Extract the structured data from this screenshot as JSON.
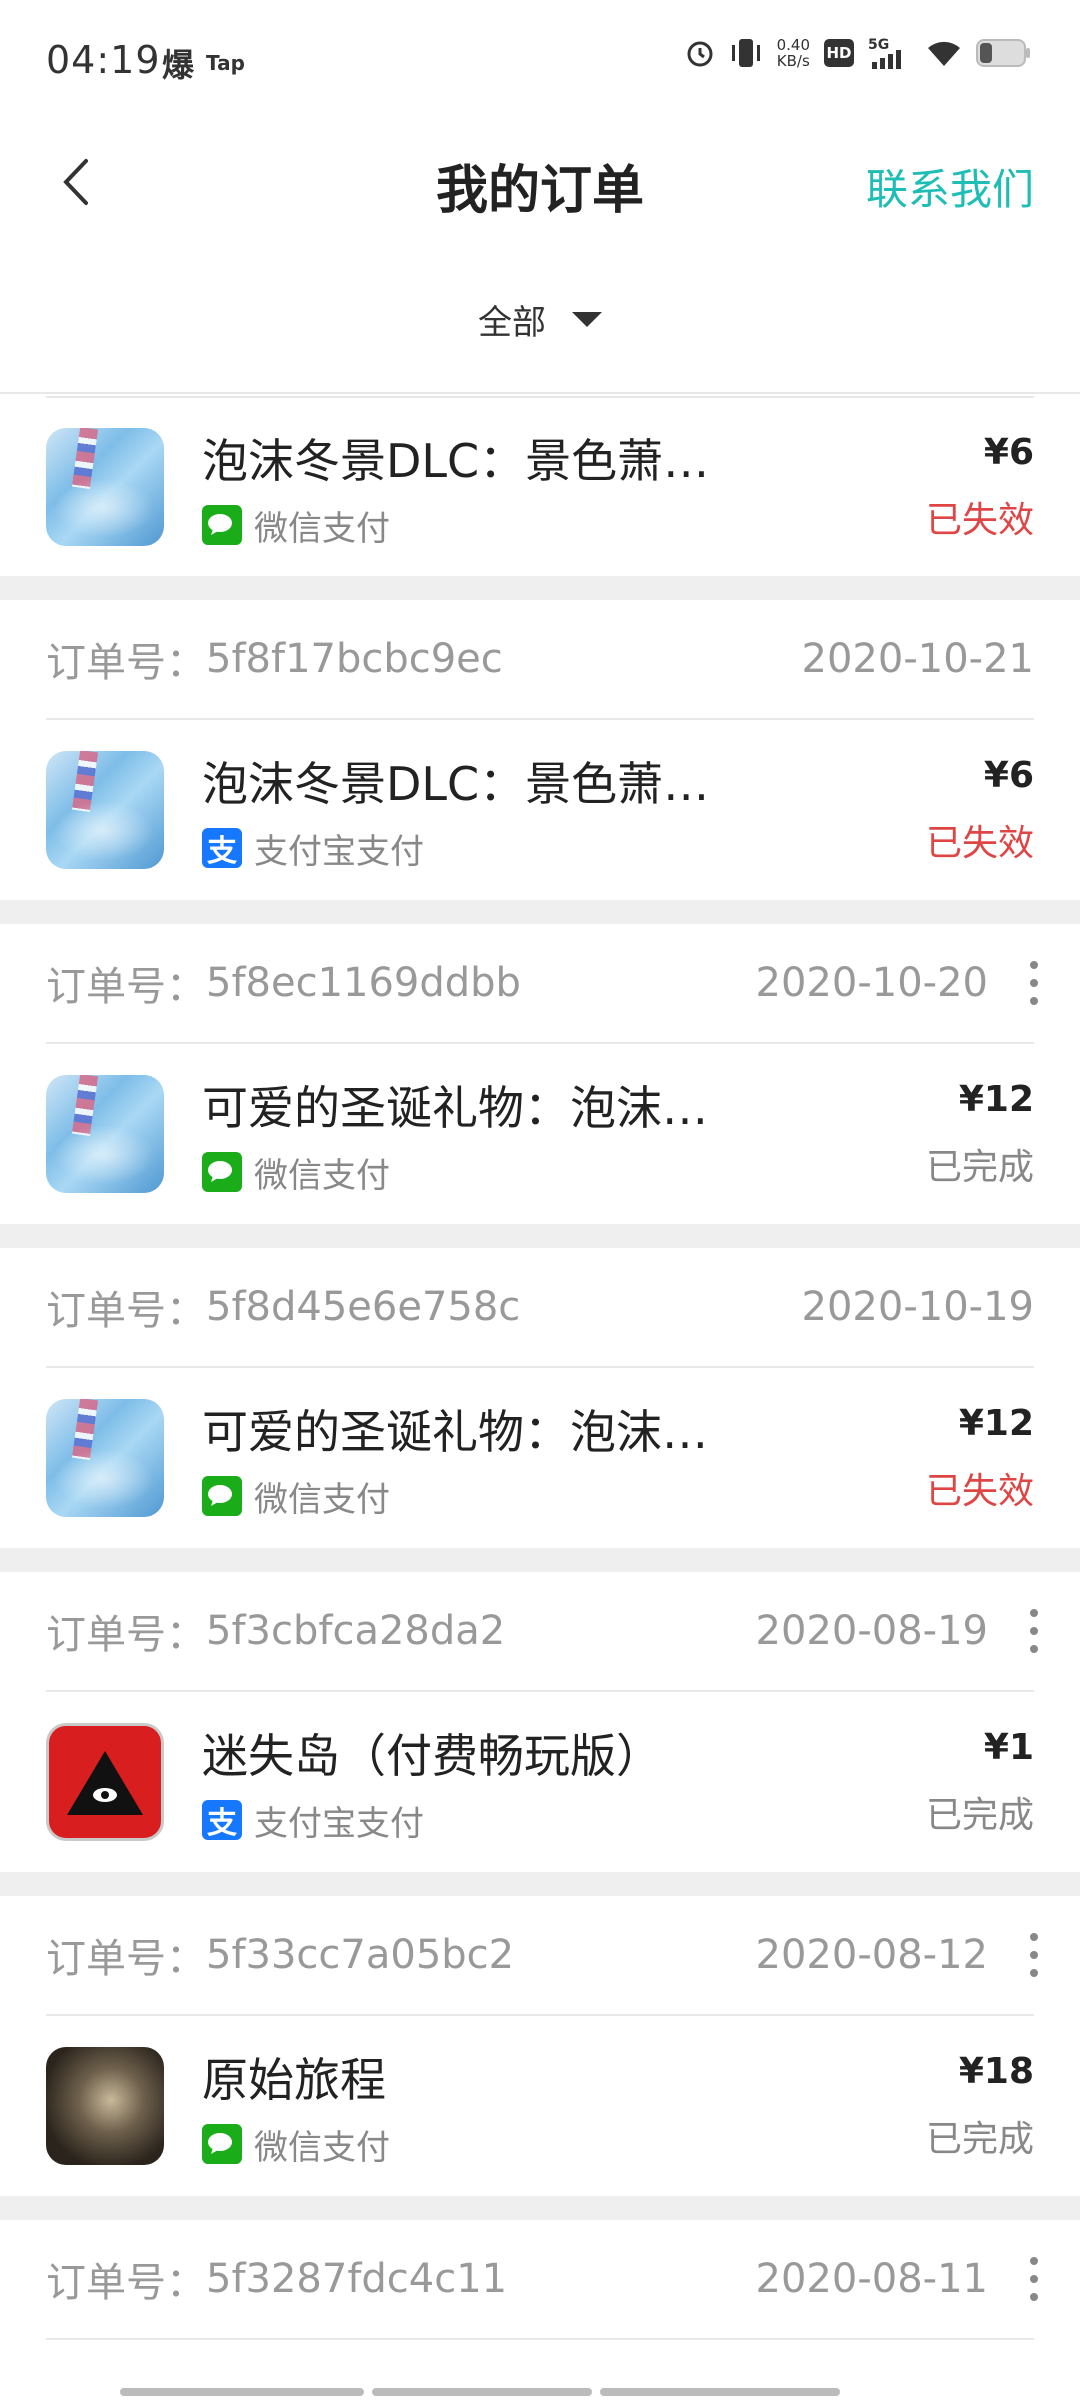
{
  "status_bar": {
    "time": "04:19",
    "left_icons": [
      "爆",
      "Tap"
    ],
    "net_speed_value": "0.40",
    "net_speed_unit": "KB/s",
    "hd": "HD",
    "network": "5G"
  },
  "header": {
    "title": "我的订单",
    "contact": "联系我们"
  },
  "filter": {
    "label": "全部"
  },
  "orders": [
    {
      "id_label": "",
      "id": "",
      "date": "",
      "name": "泡沫冬景DLC：景色萧瑟的冬日",
      "payment": "微信支付",
      "payment_type": "wechat",
      "price": "¥6",
      "status": "已失效",
      "status_type": "invalid",
      "thumb": "bubble"
    },
    {
      "id_label": "订单号：",
      "id": "5f8f17bcbc9ec",
      "date": "2020-10-21",
      "name": "泡沫冬景DLC：景色萧瑟的冬日",
      "payment": "支付宝支付",
      "payment_type": "alipay",
      "price": "¥6",
      "status": "已失效",
      "status_type": "invalid",
      "thumb": "bubble"
    },
    {
      "id_label": "订单号：",
      "id": "5f8ec1169ddbb",
      "date": "2020-10-20",
      "name": "可爱的圣诞礼物：泡沫冬景",
      "payment": "微信支付",
      "payment_type": "wechat",
      "price": "¥12",
      "status": "已完成",
      "status_type": "done",
      "thumb": "bubble"
    },
    {
      "id_label": "订单号：",
      "id": "5f8d45e6e758c",
      "date": "2020-10-19",
      "name": "可爱的圣诞礼物：泡沫冬景",
      "payment": "微信支付",
      "payment_type": "wechat",
      "price": "¥12",
      "status": "已失效",
      "status_type": "invalid",
      "thumb": "bubble"
    },
    {
      "id_label": "订单号：",
      "id": "5f3cbfca28da2",
      "date": "2020-08-19",
      "name": "迷失岛（付费畅玩版）",
      "payment": "支付宝支付",
      "payment_type": "alipay",
      "price": "¥1",
      "status": "已完成",
      "status_type": "done",
      "thumb": "lost"
    },
    {
      "id_label": "订单号：",
      "id": "5f33cc7a05bc2",
      "date": "2020-08-12",
      "name": "原始旅程",
      "payment": "微信支付",
      "payment_type": "wechat",
      "price": "¥18",
      "status": "已完成",
      "status_type": "done",
      "thumb": "primal"
    },
    {
      "id_label": "订单号：",
      "id": "5f3287fdc4c11",
      "date": "2020-08-11"
    }
  ],
  "colors": {
    "accent": "#1ebdb6",
    "invalid": "#e04545",
    "wechat": "#1aad19",
    "alipay": "#1677ff"
  }
}
